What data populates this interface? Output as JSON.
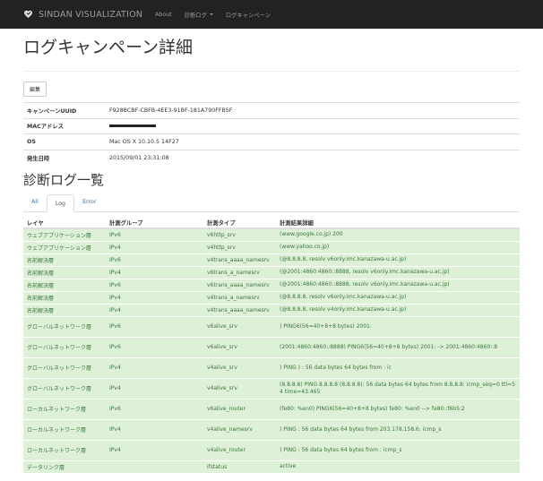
{
  "nav": {
    "brand": "SINDAN VISUALIZATION",
    "links": [
      "About",
      "診断ログ",
      "ログキャンペーン"
    ]
  },
  "page_title": "ログキャンペーン詳細",
  "edit_button": "編集",
  "info": [
    {
      "key": "キャンペーンUUID",
      "value": "F928BCBF-CBFB-4EE3-91BF-181A790FFB5F"
    },
    {
      "key": "MACアドレス",
      "value": ""
    },
    {
      "key": "OS",
      "value": "Mac OS X 10.10.5 14F27"
    },
    {
      "key": "発生日時",
      "value": "2015/09/01 23:31:08"
    }
  ],
  "section_title": "診断ログ一覧",
  "tabs": [
    "All",
    "Log",
    "Error"
  ],
  "active_tab": "Log",
  "log_headers": [
    "レイヤ",
    "計測グループ",
    "計測タイプ",
    "計測結果詳細"
  ],
  "log_rows": [
    {
      "layer": "ウェブアプリケーション層",
      "group": "IPv6",
      "type": "v6http_srv",
      "detail": "(www.google.co.jp) 200"
    },
    {
      "layer": "ウェブアプリケーション層",
      "group": "IPv4",
      "type": "v4http_srv",
      "detail": "(www.yahoo.co.jp)"
    },
    {
      "layer": "名前解決層",
      "group": "IPv6",
      "type": "v4trans_aaaa_namesrv",
      "detail": "(@8.8.8.8, resolv v6only.imc.kanazawa-u.ac.jp)"
    },
    {
      "layer": "名前解決層",
      "group": "IPv4",
      "type": "v6trans_a_namesrv",
      "detail": "(@2001:4860:4860::8888, resolv v6only.imc.kanazawa-u.ac.jp)"
    },
    {
      "layer": "名前解決層",
      "group": "IPv6",
      "type": "v6trans_aaaa_namesrv",
      "detail": "(@2001:4860:4860::8888, resolv v6only.imc.kanazawa-u.ac.jp)"
    },
    {
      "layer": "名前解決層",
      "group": "IPv4",
      "type": "v4trans_a_namesrv",
      "detail": "(@8.8.8.8, resolv v6only.imc.kanazawa-u.ac.jp)"
    },
    {
      "layer": "名前解決層",
      "group": "IPv4",
      "type": "v4trans_aaaa_namesrv",
      "detail": "(@8.8.8.8, resolv v4only.imc.kanazawa-u.ac.jp)"
    },
    {
      "layer": "グローバルネットワーク層",
      "group": "IPv6",
      "type": "v6alive_srv",
      "detail": ") PING6(56=40+8+8 bytes) 2001:"
    },
    {
      "layer": "グローバルネットワーク層",
      "group": "IPv6",
      "type": "v6alive_srv",
      "detail": "(2001:4860:4860::8888) PING6(56=40+8+8 bytes) 2001: -> 2001:4860:4860::8"
    },
    {
      "layer": "グローバルネットワーク層",
      "group": "IPv4",
      "type": "v4alive_srv",
      "detail": ") PING ) : 56 data bytes 64 bytes from : ic"
    },
    {
      "layer": "グローバルネットワーク層",
      "group": "IPv4",
      "type": "v4alive_srv",
      "detail": "(8.8.8.8) PING 8.8.8.8 (8.8.8.8): 56 data bytes 64 bytes from 8.8.8.8: icmp_seq=0 ttl=54 time=43.465"
    },
    {
      "layer": "ローカルネットワーク層",
      "group": "IPv6",
      "type": "v6alive_router",
      "detail": "(fe80: %en0) PING6(56=40+8+8 bytes) fe80: %en0 --> fe80::f6b5:2"
    },
    {
      "layer": "ローカルネットワーク層",
      "group": "IPv4",
      "type": "v4alive_namesrv",
      "detail": ") PING : 56 data bytes 64 bytes from 203.178.158.6: icmp_s"
    },
    {
      "layer": "ローカルネットワーク層",
      "group": "IPv4",
      "type": "v4alive_router",
      "detail": ") PING : 56 data bytes 64 bytes from : icmp_s"
    },
    {
      "layer": "データリンク層",
      "group": "",
      "type": "ifstatus",
      "detail": "active"
    }
  ]
}
